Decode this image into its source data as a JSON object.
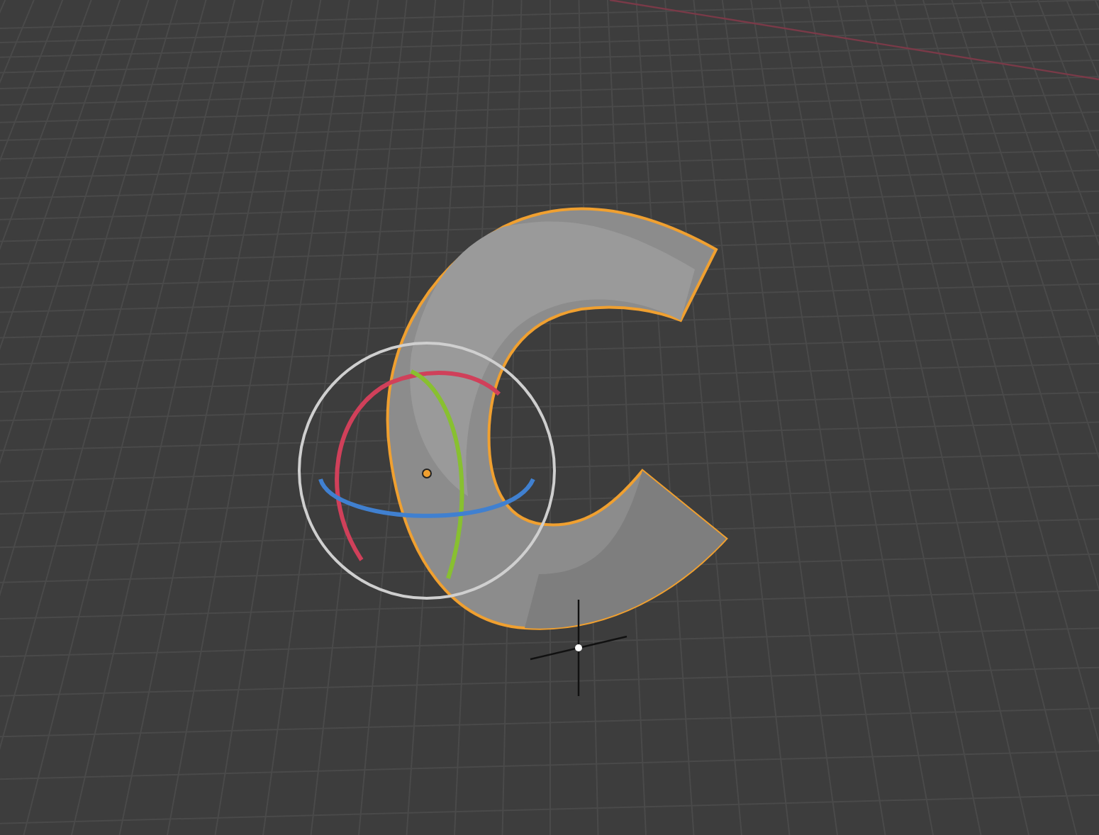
{
  "viewport": {
    "object": {
      "selected": true
    },
    "gizmo": {
      "kind": "rotate"
    }
  }
}
